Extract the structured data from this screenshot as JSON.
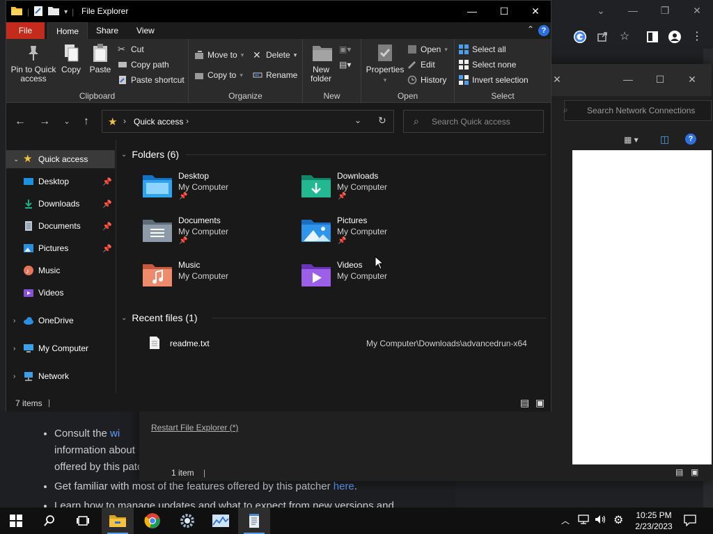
{
  "explorer": {
    "title": "File Explorer",
    "ribbon_tabs": [
      "File",
      "Home",
      "Share",
      "View"
    ],
    "help_label": "?",
    "clipboard": {
      "pin_label": "Pin to Quick access",
      "copy_label": "Copy",
      "paste_label": "Paste",
      "cut_label": "Cut",
      "copy_path_label": "Copy path",
      "paste_shortcut_label": "Paste shortcut",
      "group_label": "Clipboard"
    },
    "organize": {
      "move_to_label": "Move to",
      "copy_to_label": "Copy to",
      "delete_label": "Delete",
      "rename_label": "Rename",
      "group_label": "Organize"
    },
    "new": {
      "new_folder_label": "New folder",
      "group_label": "New"
    },
    "open": {
      "properties_label": "Properties",
      "open_label": "Open",
      "edit_label": "Edit",
      "history_label": "History",
      "group_label": "Open"
    },
    "select": {
      "select_all_label": "Select all",
      "select_none_label": "Select none",
      "invert_label": "Invert selection",
      "group_label": "Select"
    },
    "address": {
      "crumb": "Quick access",
      "separator": "›"
    },
    "search": {
      "placeholder": "Search Quick access"
    },
    "sidebar": {
      "items": [
        {
          "label": "Quick access",
          "icon": "star-icon"
        },
        {
          "label": "Desktop",
          "icon": "desktop-icon",
          "pinned": true
        },
        {
          "label": "Downloads",
          "icon": "download-icon",
          "pinned": true
        },
        {
          "label": "Documents",
          "icon": "documents-icon",
          "pinned": true
        },
        {
          "label": "Pictures",
          "icon": "pictures-icon",
          "pinned": true
        },
        {
          "label": "Music",
          "icon": "music-icon"
        },
        {
          "label": "Videos",
          "icon": "videos-icon"
        },
        {
          "label": "OneDrive",
          "icon": "cloud-icon"
        },
        {
          "label": "My Computer",
          "icon": "computer-icon"
        },
        {
          "label": "Network",
          "icon": "network-icon"
        }
      ]
    },
    "folders_header": "Folders (6)",
    "folders": [
      {
        "name": "Desktop",
        "location": "My Computer",
        "pinned": true,
        "color": "#1e90e0"
      },
      {
        "name": "Downloads",
        "location": "My Computer",
        "pinned": true,
        "color": "#1fae8a"
      },
      {
        "name": "Documents",
        "location": "My Computer",
        "pinned": true,
        "color": "#7a8898"
      },
      {
        "name": "Pictures",
        "location": "My Computer",
        "pinned": true,
        "color": "#2b8fe0"
      },
      {
        "name": "Music",
        "location": "My Computer",
        "pinned": false,
        "color": "#e2755b"
      },
      {
        "name": "Videos",
        "location": "My Computer",
        "pinned": false,
        "color": "#8a4fd8"
      }
    ],
    "recent_header": "Recent files (1)",
    "recent_files": [
      {
        "name": "readme.txt",
        "path": "My Computer\\Downloads\\advancedrun-x64"
      }
    ],
    "status_items": "7 items"
  },
  "network_window": {
    "search_placeholder": "Search Network Connections",
    "restart_link": "Restart File Explorer (*)",
    "status_items": "1 item"
  },
  "browser_page": {
    "bullet1_prefix": "Consult the ",
    "bullet1_link": "wi",
    "bullet1_line2": "information about",
    "bullet1_line3": "offered by this patc",
    "bullet2_text": "Get familiar with most of the features offered by this patcher ",
    "bullet2_link": "here",
    "bullet2_suffix": ".",
    "bullet3_text": "Learn how to manage updates and what to expect from new versions and"
  },
  "taskbar": {
    "time": "10:25 PM",
    "date": "2/23/2023"
  },
  "colors": {
    "accent": "#2c6fde",
    "file_tab": "#c42b1c",
    "folder_yellow": "#f6c33b"
  }
}
